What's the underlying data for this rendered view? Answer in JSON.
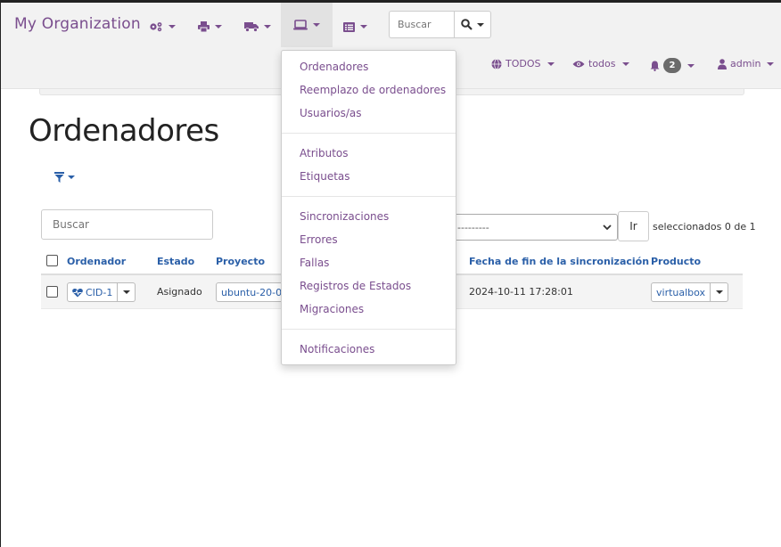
{
  "navbar": {
    "brand": "My Organization",
    "icons": [
      {
        "name": "cogs-icon"
      },
      {
        "name": "printer-icon"
      },
      {
        "name": "truck-icon"
      },
      {
        "name": "laptop-icon"
      },
      {
        "name": "list-icon"
      }
    ],
    "search_placeholder": "Buscar",
    "lineage_label": "TODOS",
    "visibility_label": "todos",
    "notifications_count": "2",
    "user_label": "admin"
  },
  "dropdown": {
    "groups": [
      [
        "Ordenadores",
        "Reemplazo de ordenadores",
        "Usuarios/as"
      ],
      [
        "Atributos",
        "Etiquetas"
      ],
      [
        "Sincronizaciones",
        "Errores",
        "Fallas",
        "Registros de Estados",
        "Migraciones"
      ],
      [
        "Notificaciones"
      ]
    ]
  },
  "page": {
    "title": "Ordenadores",
    "table_search_placeholder": "Buscar",
    "action_select_value": "---------",
    "go_button": "Ir",
    "selected_count": "seleccionados 0 de 1"
  },
  "table": {
    "headers": {
      "computer": "Ordenador",
      "status": "Estado",
      "project": "Proyecto",
      "sync_end": "Fecha de fin de la sincronización",
      "product": "Producto"
    },
    "rows": [
      {
        "computer": "CID-1",
        "status": "Asignado",
        "project": "ubuntu-20-04",
        "sync_end": "2024-10-11 17:28:01",
        "product": "virtualbox"
      }
    ]
  },
  "colors": {
    "brand": "#7a4e8e",
    "link": "#2a5fa8"
  }
}
